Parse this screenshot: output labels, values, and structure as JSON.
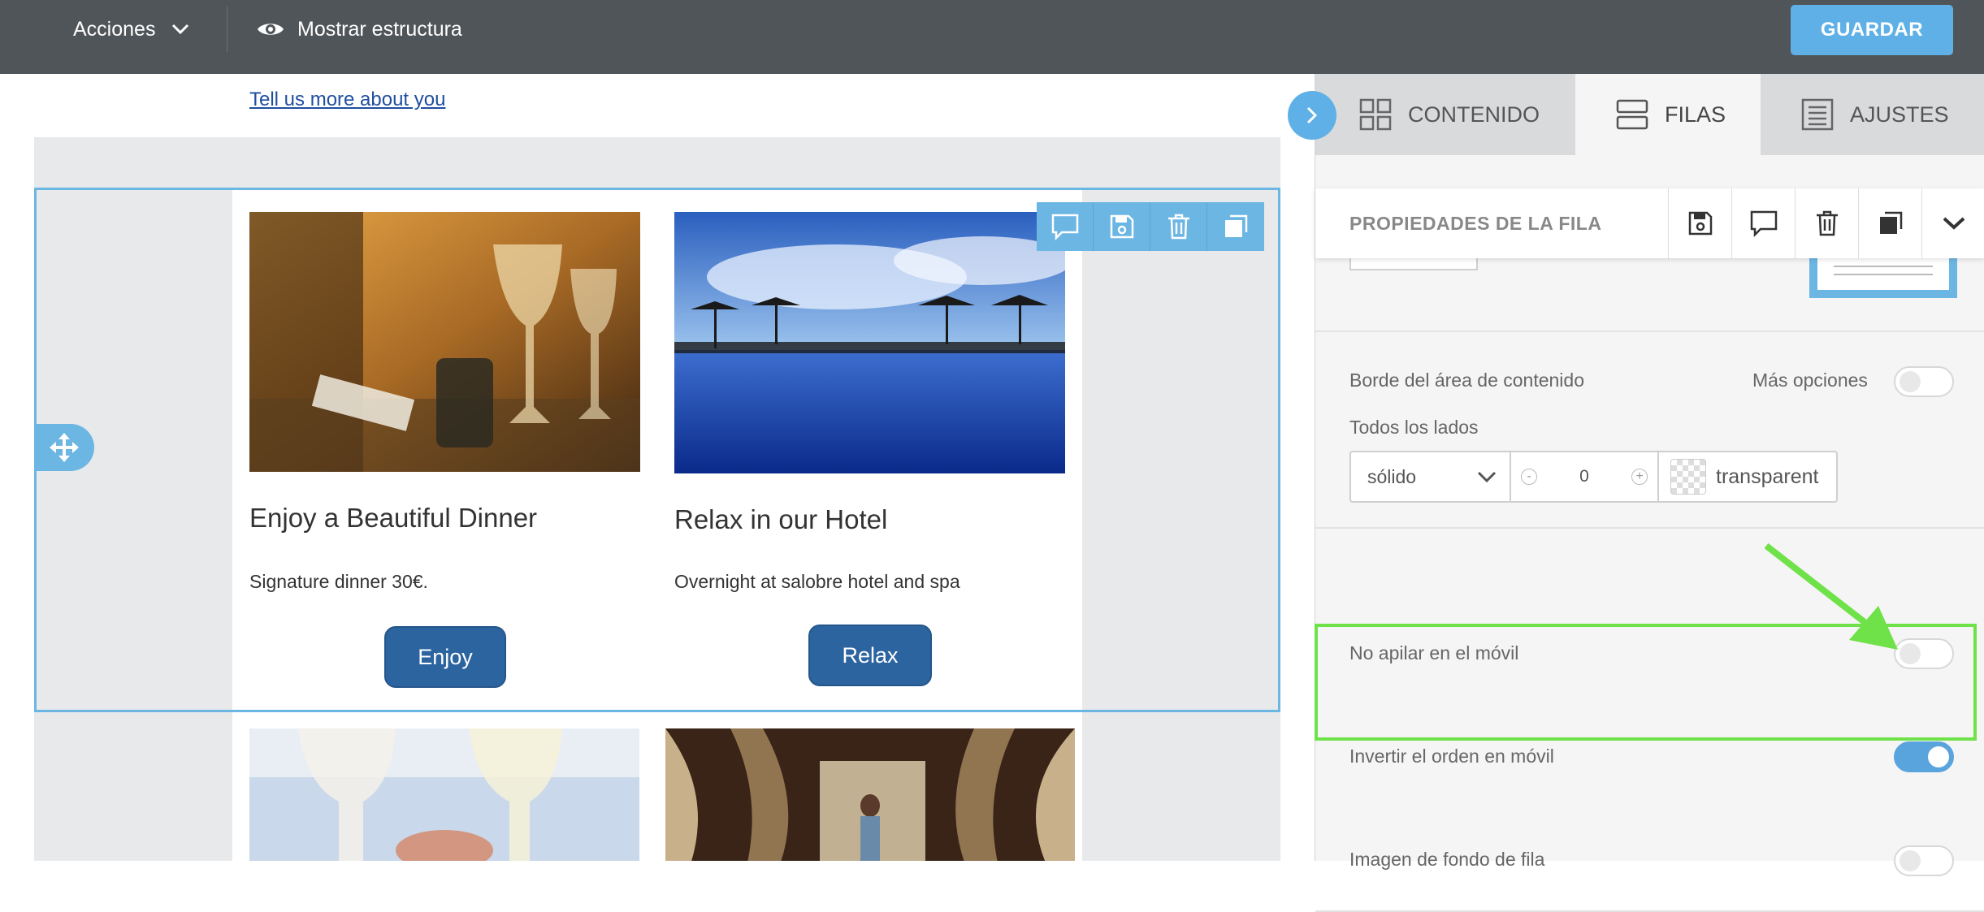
{
  "topbar": {
    "actions_label": "Acciones",
    "structure_label": "Mostrar estructura",
    "save_label": "GUARDAR"
  },
  "canvas": {
    "link_text": "Tell us more about you",
    "cards": [
      {
        "title": "Enjoy a Beautiful Dinner",
        "text": "Signature dinner 30€.",
        "button": "Enjoy"
      },
      {
        "title": "Relax in our Hotel",
        "text": "Overnight at salobre hotel and spa",
        "button": "Relax"
      }
    ]
  },
  "panel": {
    "tabs": [
      {
        "label": "CONTENIDO",
        "icon": "grid-icon",
        "active": false
      },
      {
        "label": "FILAS",
        "icon": "rows-icon",
        "active": true
      },
      {
        "label": "AJUSTES",
        "icon": "settings-icon",
        "active": false
      }
    ],
    "header_title": "PROPIEDADES DE LA FILA",
    "border": {
      "label": "Borde del área de contenido",
      "more_options": "Más opciones",
      "all_sides": "Todos los lados",
      "style": "sólido",
      "width": "0",
      "minus": "-",
      "plus": "+",
      "color": "transparent"
    },
    "no_stack_label": "No apilar en el móvil",
    "reverse_label": "Invertir el orden en móvil",
    "bg_image_label": "Imagen de fondo de fila",
    "toggles": {
      "more_options": false,
      "no_stack": false,
      "reverse": true,
      "bg_image": false
    }
  },
  "colors": {
    "topbar": "#505559",
    "accent": "#5fb0e6",
    "button_blue": "#2c64a0",
    "highlight_green": "#6fe24a"
  }
}
